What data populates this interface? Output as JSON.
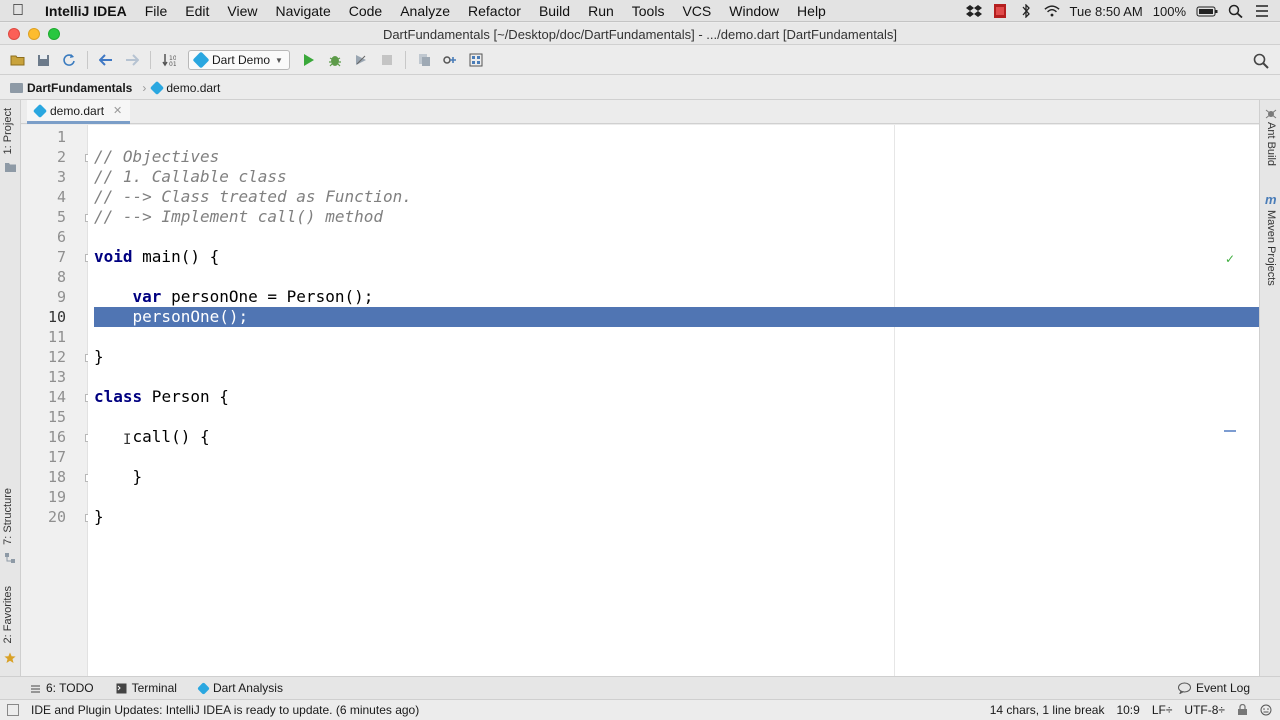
{
  "menubar": {
    "items": [
      "IntelliJ IDEA",
      "File",
      "Edit",
      "View",
      "Navigate",
      "Code",
      "Analyze",
      "Refactor",
      "Build",
      "Run",
      "Tools",
      "VCS",
      "Window",
      "Help"
    ],
    "clock": "Tue 8:50 AM",
    "battery": "100%"
  },
  "window": {
    "title": "DartFundamentals [~/Desktop/doc/DartFundamentals] - .../demo.dart [DartFundamentals]"
  },
  "toolbar": {
    "run_config": "Dart Demo"
  },
  "breadcrumb": {
    "project": "DartFundamentals",
    "file": "demo.dart"
  },
  "left_stripe": {
    "project": "1: Project",
    "structure": "7: Structure",
    "favorites": "2: Favorites"
  },
  "right_stripe": {
    "ant": "Ant Build",
    "maven": "Maven Projects",
    "maven_glyph": "m"
  },
  "editor": {
    "tab": "demo.dart",
    "current_line": 10,
    "line_numbers": [
      "1",
      "2",
      "3",
      "4",
      "5",
      "6",
      "7",
      "8",
      "9",
      "10",
      "11",
      "12",
      "13",
      "14",
      "15",
      "16",
      "17",
      "18",
      "19",
      "20"
    ],
    "lines": [
      "",
      "// Objectives",
      "// 1. Callable class",
      "// --> Class treated as Function.",
      "// --> Implement call() method",
      "",
      "void main() {",
      "",
      "    var personOne = Person();",
      "    personOne();",
      "",
      "}",
      "",
      "class Person {",
      "",
      "    call() {",
      "",
      "    }",
      "",
      "}"
    ]
  },
  "tool_windows": {
    "todo": "6: TODO",
    "terminal": "Terminal",
    "dart_analysis": "Dart Analysis",
    "event_log": "Event Log"
  },
  "status": {
    "message": "IDE and Plugin Updates: IntelliJ IDEA is ready to update. (6 minutes ago)",
    "selection": "14 chars, 1 line break",
    "position": "10:9",
    "line_sep": "LF÷",
    "encoding": "UTF-8÷"
  }
}
